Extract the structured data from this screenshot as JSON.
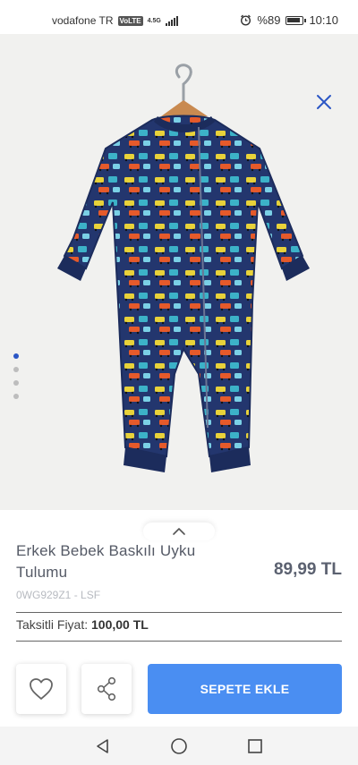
{
  "status_bar": {
    "carrier": "vodafone TR",
    "volte": "VoLTE",
    "network": "4.5G",
    "battery": "%89",
    "time": "10:10"
  },
  "gallery": {
    "total_images": 4,
    "active_index": 0
  },
  "product": {
    "title": "Erkek Bebek Baskılı Uyku Tulumu",
    "price": "89,99 TL",
    "code": "0WG929Z1 - LSF",
    "installment_label": "Taksitli Fiyat:",
    "installment_price": "100,00 TL"
  },
  "actions": {
    "add_to_cart": "SEPETE EKLE"
  },
  "colors": {
    "accent": "#4a8ef2",
    "active_dot": "#2b56c5",
    "garment_navy": "#23366e"
  },
  "icons": {
    "close": "close-icon",
    "favorite": "heart-icon",
    "share": "share-icon",
    "expand": "chevron-up-icon",
    "nav_back": "triangle-back-icon",
    "nav_home": "circle-home-icon",
    "nav_recent": "square-recent-icon"
  }
}
